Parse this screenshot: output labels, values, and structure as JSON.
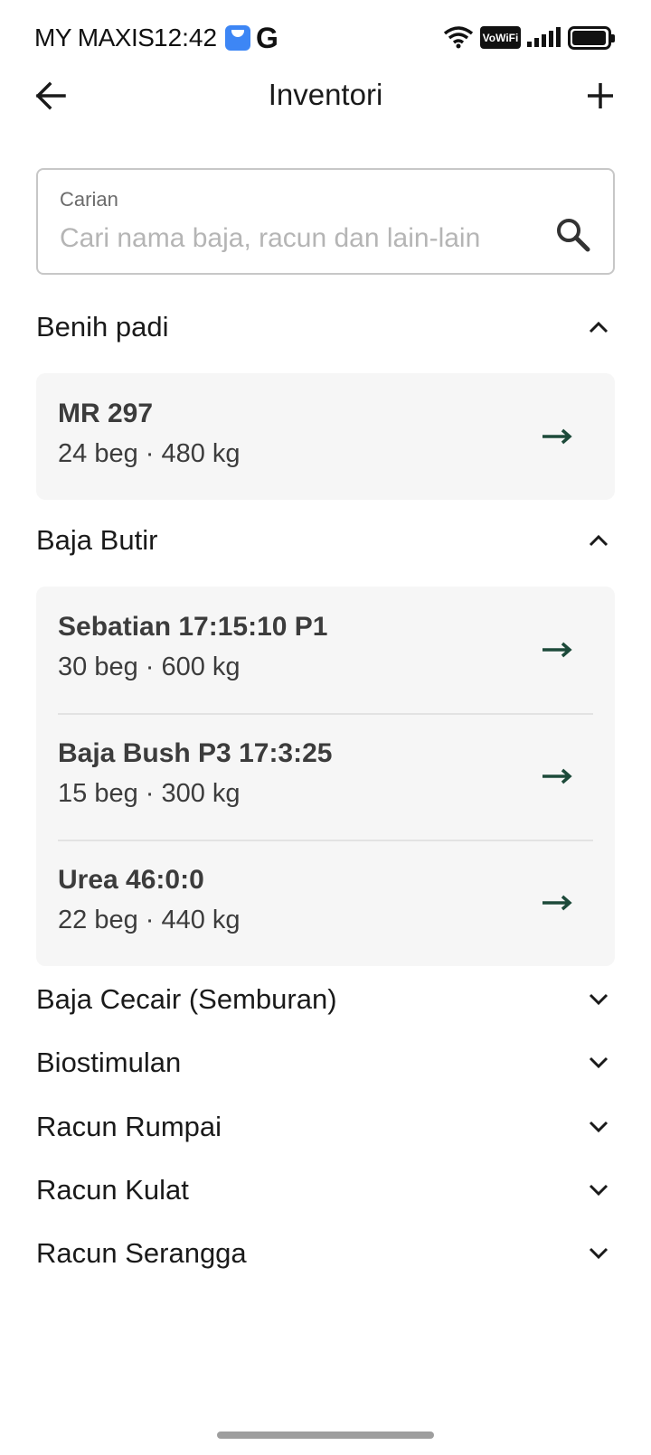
{
  "status_bar": {
    "carrier": "MY MAXIS",
    "time": "12:42",
    "vowifi": "VoWiFi"
  },
  "header": {
    "title": "Inventori",
    "back_icon": "arrow-back-icon",
    "add_icon": "plus-icon"
  },
  "search": {
    "label": "Carian",
    "placeholder": "Cari nama baja, racun dan lain-lain",
    "value": ""
  },
  "colors": {
    "accent": "#1d4a3a",
    "card_background": "#f6f6f6"
  },
  "sections": [
    {
      "title": "Benih padi",
      "expanded": true,
      "items": [
        {
          "name": "MR 297",
          "detail": "24 beg · 480 kg"
        }
      ]
    },
    {
      "title": "Baja Butir",
      "expanded": true,
      "items": [
        {
          "name": "Sebatian 17:15:10 P1",
          "detail": "30 beg · 600 kg"
        },
        {
          "name": "Baja Bush P3 17:3:25",
          "detail": "15 beg · 300 kg"
        },
        {
          "name": "Urea 46:0:0",
          "detail": "22 beg · 440 kg"
        }
      ]
    },
    {
      "title": "Baja Cecair (Semburan)",
      "expanded": false,
      "items": []
    },
    {
      "title": "Biostimulan",
      "expanded": false,
      "items": []
    },
    {
      "title": "Racun Rumpai",
      "expanded": false,
      "items": []
    },
    {
      "title": "Racun Kulat",
      "expanded": false,
      "items": []
    },
    {
      "title": "Racun Serangga",
      "expanded": false,
      "items": []
    }
  ]
}
